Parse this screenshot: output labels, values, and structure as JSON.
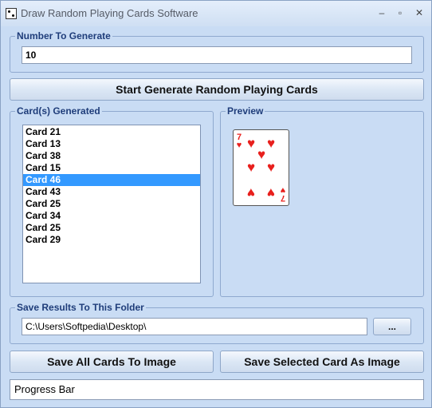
{
  "window": {
    "title": "Draw Random Playing Cards Software",
    "controls": {
      "minimize": "–",
      "maximize": "▫",
      "close": "✕"
    }
  },
  "number_group": {
    "label": "Number To Generate",
    "value": "10"
  },
  "generate_button": {
    "label": "Start Generate Random Playing Cards"
  },
  "cards_group": {
    "label": "Card(s) Generated",
    "items": [
      "Card 21",
      "Card 13",
      "Card 38",
      "Card 15",
      "Card 46",
      "Card 43",
      "Card 25",
      "Card 34",
      "Card 25",
      "Card 29"
    ],
    "selected_index": 4
  },
  "preview_group": {
    "label": "Preview",
    "card": {
      "rank": "7",
      "suit": "♥",
      "color": "#e8201d"
    }
  },
  "folder_group": {
    "label": "Save Results To This Folder",
    "path": "C:\\Users\\Softpedia\\Desktop\\",
    "browse_label": "..."
  },
  "save_all_button": {
    "label": "Save All Cards To Image"
  },
  "save_selected_button": {
    "label": "Save Selected Card As Image"
  },
  "progress": {
    "label": "Progress Bar"
  }
}
